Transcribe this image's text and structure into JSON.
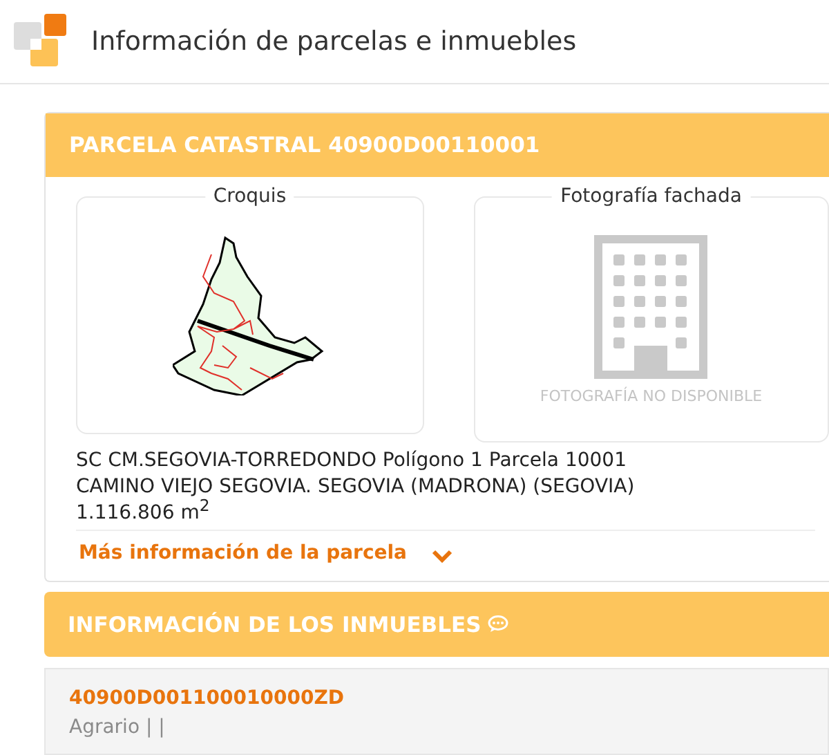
{
  "page_title": "Información de parcelas e inmuebles",
  "parcel": {
    "title": "PARCELA CATASTRAL 40900D00110001",
    "sketch": {
      "label": "Croquis"
    },
    "photo": {
      "label": "Fotografía fachada",
      "caption": "FOTOGRAFÍA NO DISPONIBLE"
    },
    "address_lines": [
      "SC CM.SEGOVIA-TORREDONDO Polígono 1 Parcela 10001",
      "CAMINO VIEJO SEGOVIA. SEGOVIA (MADRONA) (SEGOVIA)"
    ],
    "area": "1.116.806 m$^{2}$",
    "more_link": {
      "label": "Más información de la parcela",
      "expanded": false
    }
  },
  "properties": {
    "title": "INFORMACIÓN DE LOS INMUEBLES",
    "items": [
      {
        "reference": "40900D001100010000ZD",
        "use": "Agrario | |"
      }
    ]
  }
}
